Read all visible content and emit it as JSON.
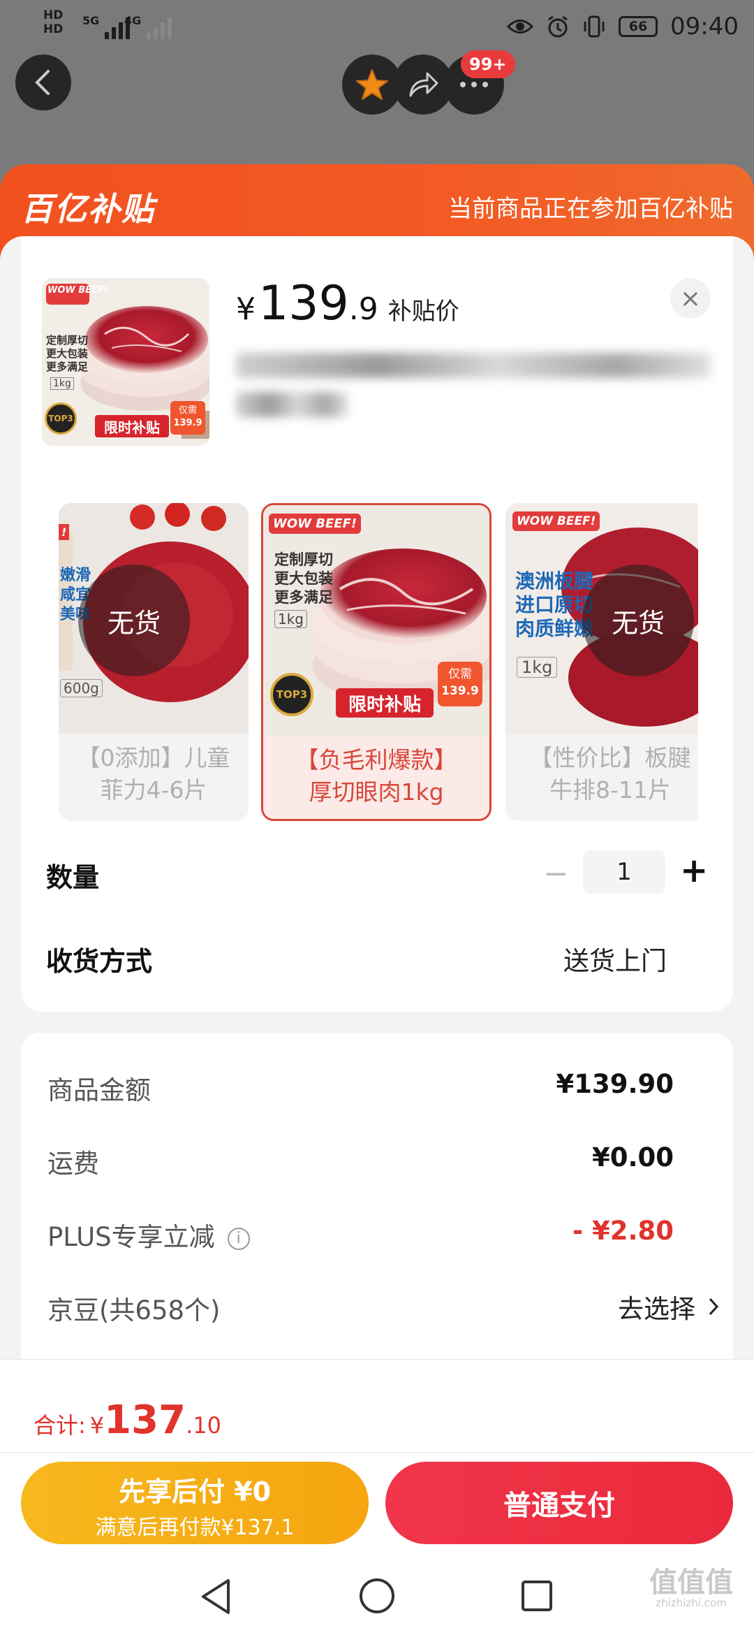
{
  "status_bar": {
    "hd1": "HD",
    "hd2": "HD",
    "net1": "5G",
    "net2": "4G",
    "battery": "66",
    "time": "09:40"
  },
  "nav": {
    "badge": "99+"
  },
  "subsidy": {
    "logo": "百亿补贴",
    "note": "当前商品正在参加百亿补贴"
  },
  "product": {
    "price_yen": "¥",
    "price_int": "139",
    "price_dec": ".9",
    "price_label": "补贴价",
    "close": "×",
    "thumb_logo": "WOW BEEF!",
    "thumb_lines": [
      "定制厚切",
      "更大包装",
      "更多满足"
    ],
    "thumb_weight": "1kg",
    "thumb_banner": "限时补贴",
    "thumb_price_tag": "仅需",
    "thumb_price_val": "139.9"
  },
  "variants": [
    {
      "caption_1": "【0添加】儿童",
      "caption_2": "菲力4-6片",
      "soldout": "无货",
      "img_text": [
        "嫩滑",
        "咸宜",
        "美味"
      ],
      "weight": "600g"
    },
    {
      "caption_1": "【负毛利爆款】",
      "caption_2": "厚切眼肉1kg",
      "img_lines": [
        "定制厚切",
        "更大包装",
        "更多满足"
      ],
      "weight": "1kg",
      "banner": "限时补贴",
      "tag": "仅需",
      "tag_val": "139.9",
      "logo": "WOW BEEF!"
    },
    {
      "caption_1": "【性价比】板腱",
      "caption_2": "牛排8-11片",
      "soldout": "无货",
      "img_lines": [
        "澳洲板腱",
        "进口原切",
        "肉质鲜嫩"
      ],
      "weight": "1kg",
      "logo": "WOW BEEF!"
    }
  ],
  "quantity": {
    "label": "数量",
    "minus": "−",
    "value": "1",
    "plus": "+"
  },
  "delivery": {
    "label": "收货方式",
    "value": "送货上门"
  },
  "bill": {
    "goods_label": "商品金额",
    "goods_value": "¥139.90",
    "shipping_label": "运费",
    "shipping_value": "¥0.00",
    "plus_label": "PLUS专享立减",
    "plus_value": "- ¥2.80",
    "beans_label": "京豆(共658个)",
    "beans_value": "去选择"
  },
  "footer": {
    "total_label": "合计:",
    "total_yen": "¥",
    "total_int": "137",
    "total_dec": ".10",
    "later_line1": "先享后付 ¥0",
    "later_line2": "满意后再付款¥137.1",
    "pay_label": "普通支付"
  },
  "watermark": {
    "main": "值值值",
    "sub": "zhizhizhi.com"
  },
  "colors": {
    "accent_red": "#e0332b",
    "subsidy_orange": "#f2501f",
    "pay_red": "#ee2f42",
    "later_yellow": "#f6ae16"
  }
}
